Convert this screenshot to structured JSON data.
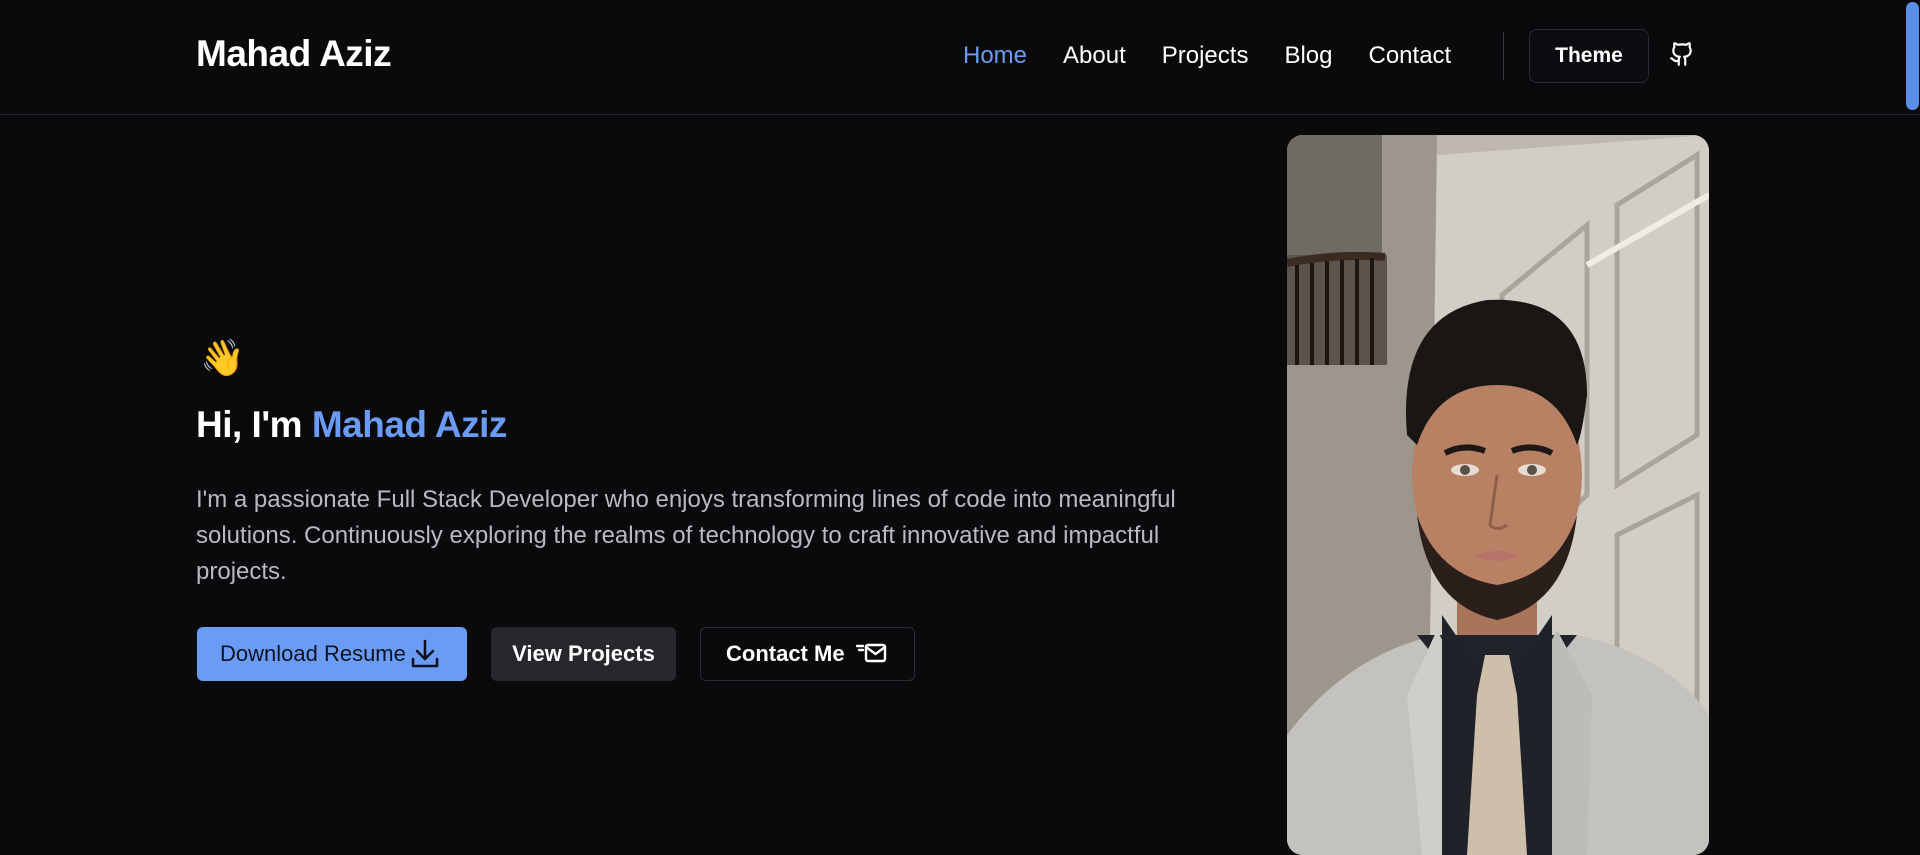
{
  "header": {
    "brand": "Mahad Aziz",
    "nav": [
      {
        "label": "Home",
        "active": true
      },
      {
        "label": "About",
        "active": false
      },
      {
        "label": "Projects",
        "active": false
      },
      {
        "label": "Blog",
        "active": false
      },
      {
        "label": "Contact",
        "active": false
      }
    ],
    "theme_button": "Theme",
    "github_icon": "github-icon"
  },
  "hero": {
    "wave_emoji": "👋",
    "greeting": "Hi, I'm ",
    "name": "Mahad Aziz",
    "description": "I'm a passionate Full Stack Developer who enjoys transforming lines of code into meaningful solutions. Continuously exploring the realms of technology to craft innovative and impactful projects.",
    "buttons": {
      "download_resume": "Download Resume",
      "view_projects": "View Projects",
      "contact_me": "Contact Me"
    },
    "icons": {
      "download": "download-icon",
      "mail": "mail-send-icon"
    },
    "photo": "profile-photo"
  },
  "colors": {
    "background": "#0a0a0d",
    "accent": "#6a9cf5",
    "text": "#ffffff",
    "muted_text": "#b9b9c2",
    "secondary_button": "#27272c"
  }
}
